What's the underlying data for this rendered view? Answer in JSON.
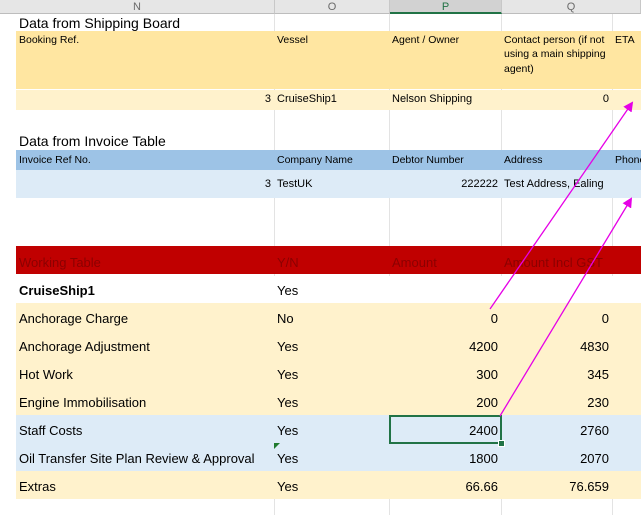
{
  "column_headers": [
    "N",
    "O",
    "P",
    "Q"
  ],
  "shipping": {
    "section_title": "Data from Shipping Board",
    "headers": {
      "booking_ref": "Booking Ref.",
      "vessel": "Vessel",
      "agent_owner": "Agent / Owner",
      "contact_line1": "Contact person (if not",
      "contact_line2": "using a main shipping",
      "contact_line3": "agent)",
      "eta": "ETA"
    },
    "row": {
      "booking_ref": "3",
      "vessel": "CruiseShip1",
      "agent_owner": "Nelson Shipping",
      "contact_person": "0"
    }
  },
  "invoice": {
    "section_title": "Data from Invoice Table",
    "headers": {
      "invoice_ref": "Invoice Ref No.",
      "company_name": "Company Name",
      "debtor_number": "Debtor Number",
      "address": "Address",
      "phone": "Phone"
    },
    "row": {
      "invoice_ref": "3",
      "company_name": "TestUK",
      "debtor_number": "222222",
      "address": "Test Address, Ealing"
    }
  },
  "working": {
    "headers": {
      "title": "Working Table",
      "yn": "Y/N",
      "amount": "Amount",
      "amount_gst": "Amount Incl GST"
    },
    "vessel_row": {
      "label": "CruiseShip1",
      "yn": "Yes"
    },
    "rows": [
      {
        "label": "Anchorage Charge",
        "yn": "No",
        "amount": "0",
        "amount_gst": "0"
      },
      {
        "label": "Anchorage Adjustment",
        "yn": "Yes",
        "amount": "4200",
        "amount_gst": "4830"
      },
      {
        "label": "Hot Work",
        "yn": "Yes",
        "amount": "300",
        "amount_gst": "345"
      },
      {
        "label": "Engine Immobilisation",
        "yn": "Yes",
        "amount": "200",
        "amount_gst": "230"
      },
      {
        "label": "Staff Costs",
        "yn": "Yes",
        "amount": "2400",
        "amount_gst": "2760"
      },
      {
        "label": "Oil Transfer Site Plan Review & Approval",
        "yn": "Yes",
        "amount": "1800",
        "amount_gst": "2070"
      },
      {
        "label": "Extras",
        "yn": "Yes",
        "amount": "66.66",
        "amount_gst": "76.659"
      }
    ]
  },
  "colors": {
    "shipping_fill": "#ffe6a1",
    "shipping_row_fill": "#fff2cc",
    "invoice_header_fill": "#9dc3e6",
    "invoice_row_fill": "#ddebf7",
    "working_header_fill": "#c00000",
    "working_header_text": "#8b0000",
    "row_cream": "#fff2cc",
    "row_blue": "#ddebf7",
    "selection": "#217346",
    "arrow": "#e600e6"
  },
  "selected_cell": "P-staff-costs"
}
